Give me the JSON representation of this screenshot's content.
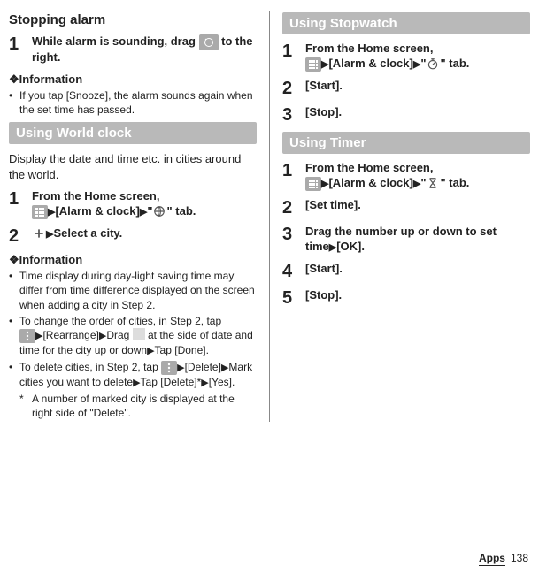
{
  "left": {
    "stopping_title": "Stopping alarm",
    "step1": "While alarm is sounding, drag ",
    "step1_end": " to the right.",
    "info_heading": "❖Information",
    "bullet1": "If you tap [Snooze], the alarm sounds again when the set time has passed.",
    "world_clock_heading": "Using World clock",
    "world_desc": "Display the date and time etc. in cities around the world.",
    "wc_step1_a": "From the Home screen, ",
    "wc_step1_b": "[Alarm & clock]",
    "wc_step1_c": "\"",
    "wc_step1_d": "\" tab.",
    "wc_step2": "Select a city.",
    "wc_bullet1": "Time display during day-light saving time may differ from time difference displayed on the screen when adding a city in Step 2.",
    "wc_bullet2_a": "To change the order of cities, in Step 2, tap ",
    "wc_bullet2_b": "[Rearrange]",
    "wc_bullet2_c": "Drag ",
    "wc_bullet2_d": " at the side of date and time for the city up or down",
    "wc_bullet2_e": "Tap [Done].",
    "wc_bullet3_a": "To delete cities, in Step 2, tap ",
    "wc_bullet3_b": "[Delete]",
    "wc_bullet3_c": "Mark cities you want to delete",
    "wc_bullet3_d": "Tap [Delete]",
    "wc_bullet3_e": "[Yes].",
    "wc_footnote": "A number of marked city is displayed at the right side of \"Delete\"."
  },
  "right": {
    "stopwatch_heading": "Using Stopwatch",
    "sw_step1_a": "From the Home screen, ",
    "sw_step1_b": "[Alarm & clock]",
    "sw_step1_c": "\"",
    "sw_step1_d": "\" tab.",
    "sw_step2": "[Start].",
    "sw_step3": "[Stop].",
    "timer_heading": "Using Timer",
    "tm_step1_a": "From the Home screen, ",
    "tm_step1_b": "[Alarm & clock]",
    "tm_step1_c": "\"",
    "tm_step1_d": "\" tab.",
    "tm_step2": "[Set time].",
    "tm_step3_a": "Drag the number up or down to set time",
    "tm_step3_b": "[OK].",
    "tm_step4": "[Start].",
    "tm_step5": "[Stop]."
  },
  "footer": {
    "apps": "Apps",
    "page": "138"
  }
}
